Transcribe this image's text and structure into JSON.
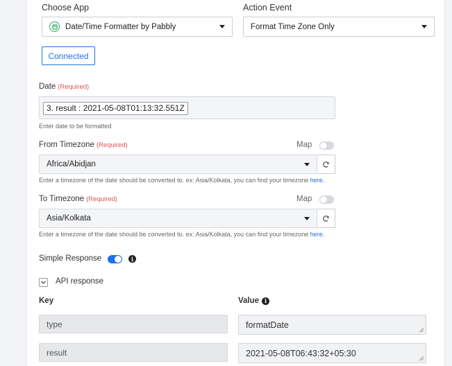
{
  "app_section": {
    "choose_app_label": "Choose App",
    "app_name": "Date/Time Formatter by Pabbly",
    "action_event_label": "Action Event",
    "action_event": "Format Time Zone Only",
    "connected_label": "Connected"
  },
  "date_field": {
    "label": "Date",
    "required": "(Required)",
    "value": "3. result : 2021-05-08T01:13:32.551Z",
    "help": "Enter date to be formatted"
  },
  "from_timezone": {
    "label": "From Timezone",
    "required": "(Required)",
    "map_label": "Map",
    "value": "Africa/Abidjan",
    "help": "Enter a timezone of the date should be converted to. ex: Asia/Kolkata, you can find your timezone",
    "help_link": "here."
  },
  "to_timezone": {
    "label": "To Timezone",
    "required": "(Required)",
    "map_label": "Map",
    "value": "Asia/Kolkata",
    "help": "Enter a timezone of the date should be converted to. ex: Asia/Kolkata, you can find your timezone",
    "help_link": "here."
  },
  "simple_response": {
    "label": "Simple Response",
    "enabled": true
  },
  "api_response": {
    "label": "API response",
    "key_header": "Key",
    "value_header": "Value",
    "rows": [
      {
        "key": "type",
        "value": "formatDate"
      },
      {
        "key": "result",
        "value": "2021-05-08T06:43:32+05:30"
      }
    ]
  },
  "colors": {
    "accent": "#1a73e8",
    "required": "#d9534f",
    "app_icon": "#27ae60"
  }
}
